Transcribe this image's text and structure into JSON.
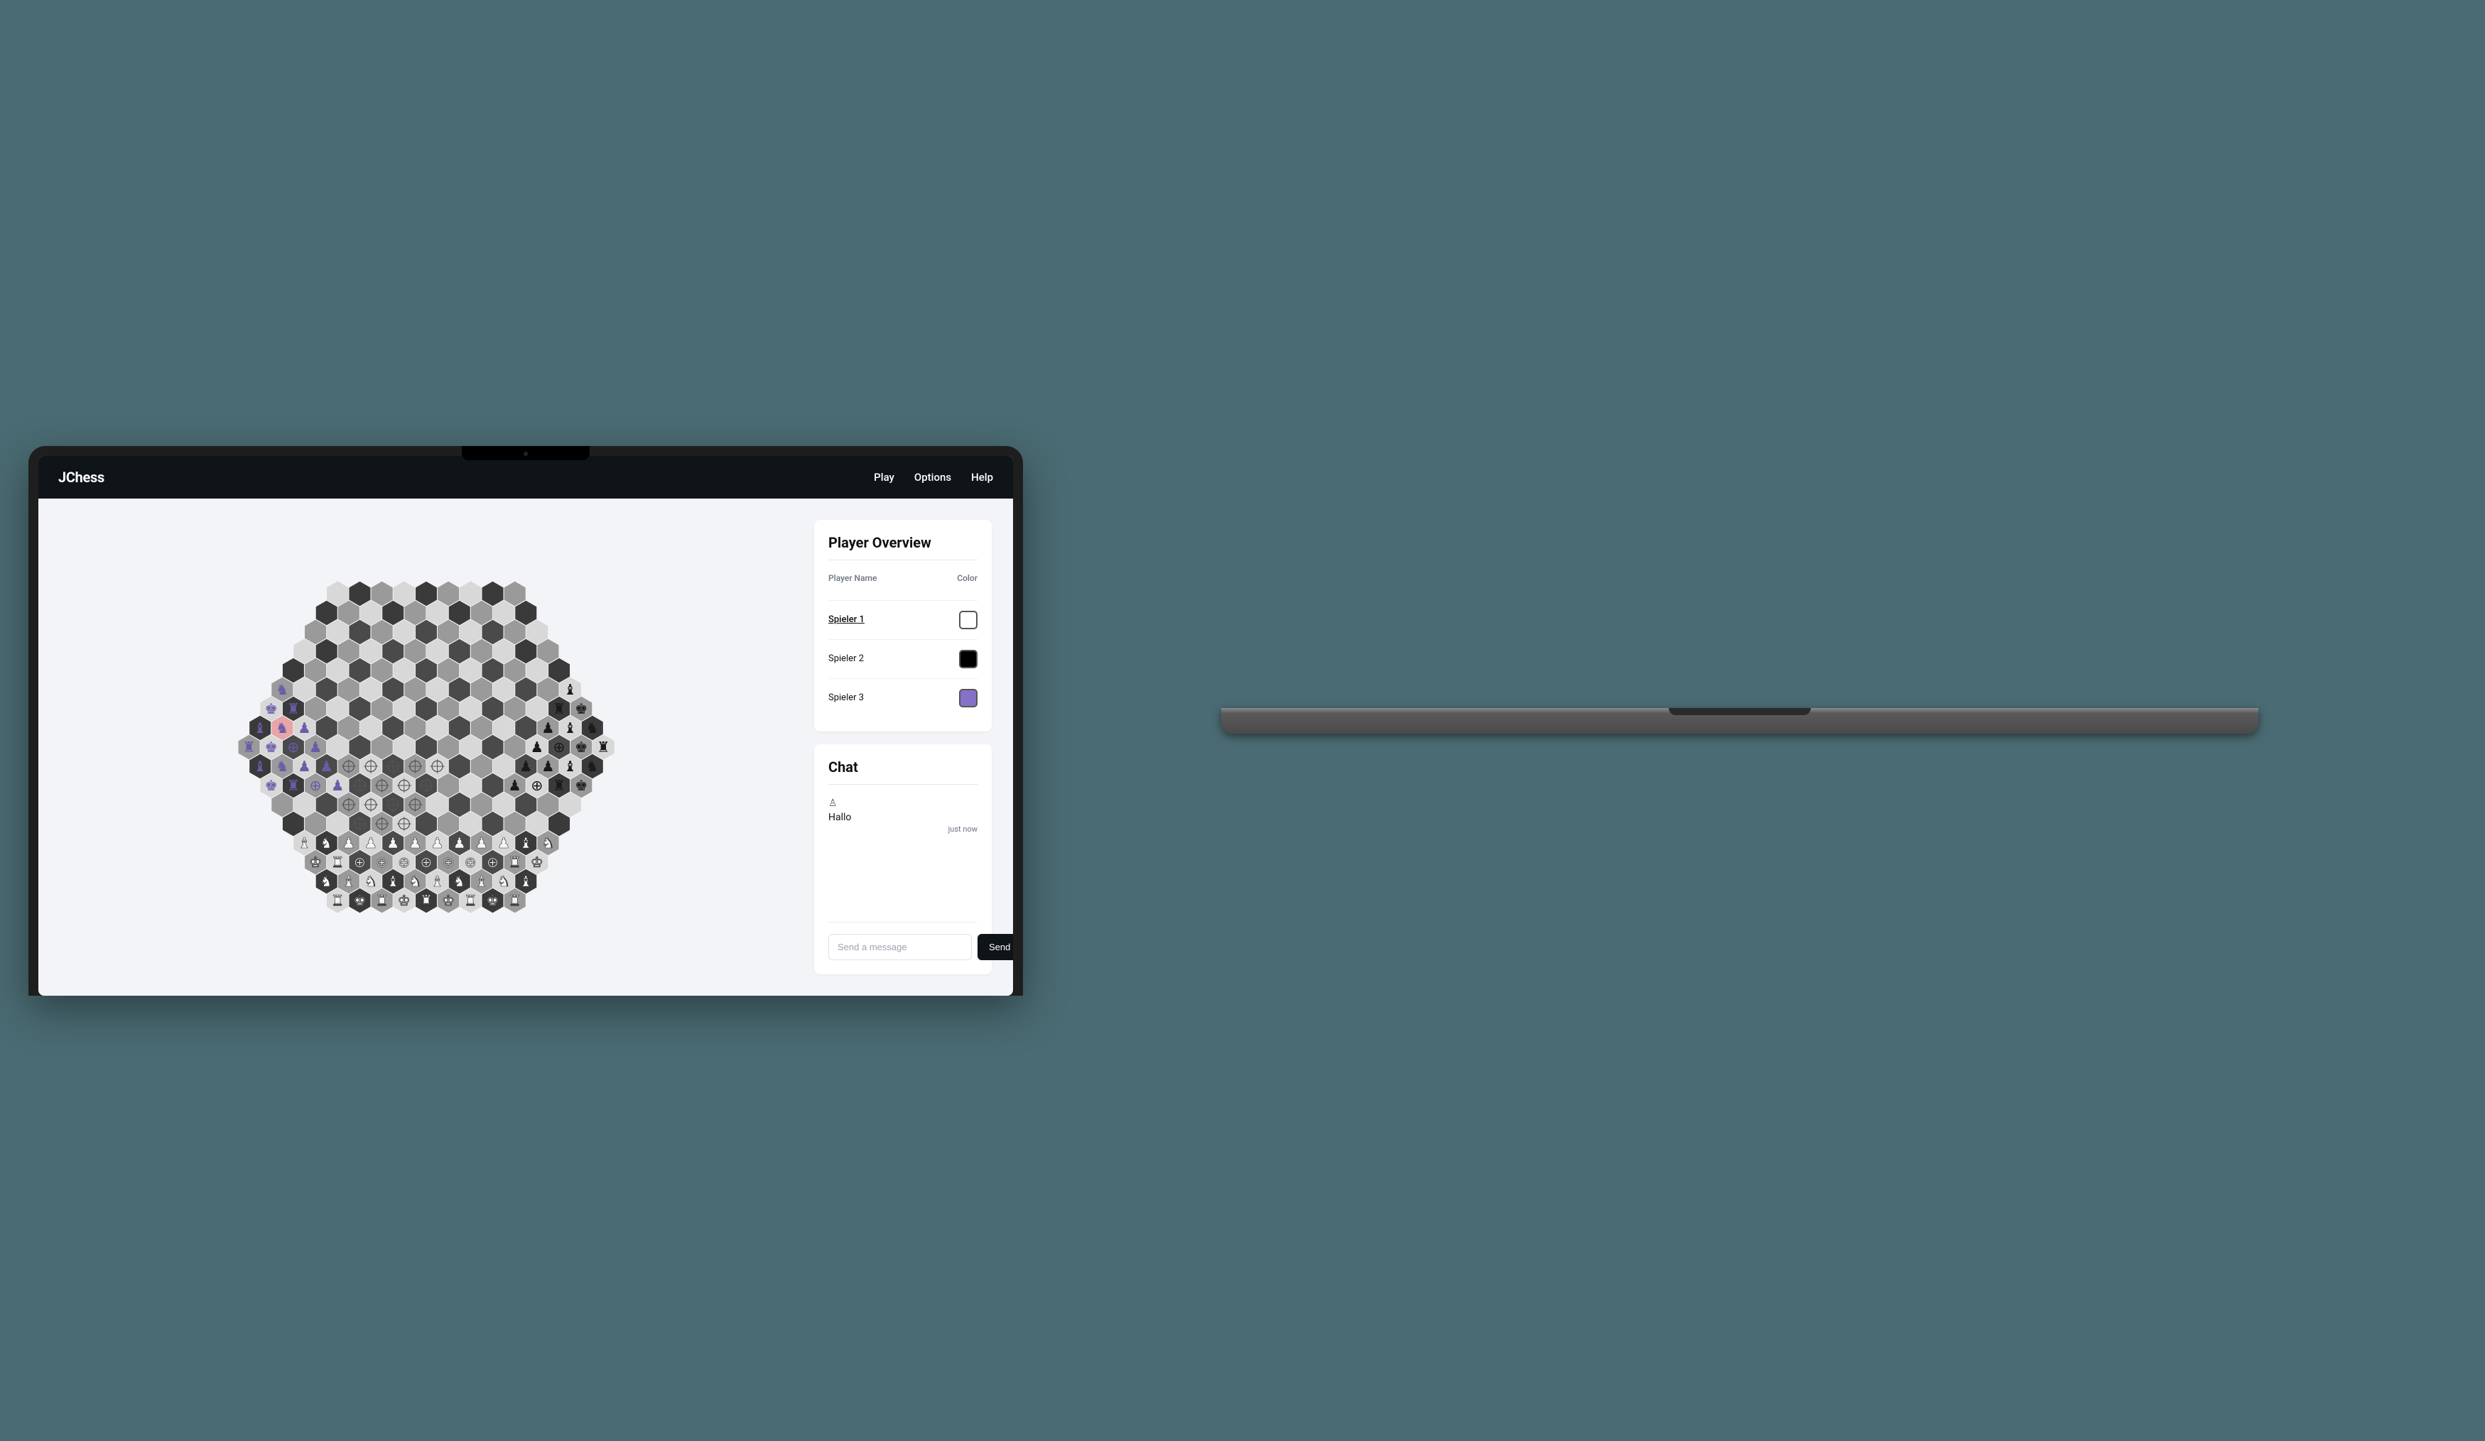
{
  "app": {
    "title": "JChess"
  },
  "nav": {
    "play": "Play",
    "options": "Options",
    "help": "Help"
  },
  "overview": {
    "title": "Player Overview",
    "headers": {
      "name": "Player Name",
      "color": "Color"
    },
    "players": [
      {
        "name": "Spieler 1",
        "color": "#ffffff",
        "active": true
      },
      {
        "name": "Spieler 2",
        "color": "#000000",
        "active": false
      },
      {
        "name": "Spieler 3",
        "color": "#8572c8",
        "active": false
      }
    ]
  },
  "chat": {
    "title": "Chat",
    "messages": [
      {
        "sender_icon": "♙",
        "text": "Hallo",
        "time": "just now"
      }
    ],
    "placeholder": "Send a message",
    "send_label": "Send"
  },
  "board": {
    "hex_size": 18,
    "colors": {
      "light": "#d8d8d8",
      "mid": "#9a9a9a",
      "dark": "#4a4a4a",
      "darker": "#3a3a3a",
      "highlight": "#e8a5a8",
      "purple_piece": "#6b5ba8",
      "black_piece": "#1a1a1a",
      "white_piece": "#f5f5f5"
    }
  }
}
